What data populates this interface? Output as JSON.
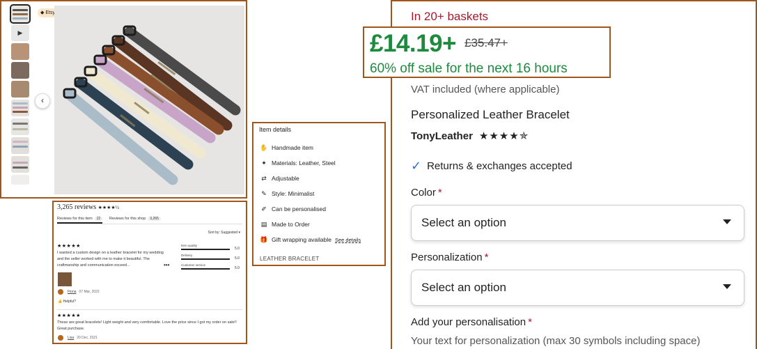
{
  "gallery": {
    "badge": "Etsy's Pick",
    "prev_glyph": "‹",
    "play_glyph": "▶",
    "thumb_count": 10
  },
  "reviews": {
    "count_label": "3,265 reviews",
    "stars": "★★★★½",
    "tab_item": "Reviews for this item",
    "tab_item_count": "22",
    "tab_shop": "Reviews for this shop",
    "tab_shop_count": "3,265",
    "sort_label": "Sort by: Suggested",
    "items": [
      {
        "stars": "★★★★★",
        "text": "I wanted a custom design on a leather bracelet for my wedding and the seller worked with me to make it beautiful. The craftmanship and communication exceed...",
        "author": "Fiona",
        "date": "07 Mar, 2022",
        "helpful": "Helpful?"
      },
      {
        "stars": "★★★★★",
        "text": "These are great bracelets! Light weight and very comfortable. Love the price since I got my order on sale!! Great purchase.",
        "author": "Lisa",
        "date": "20 Dec, 2021"
      }
    ],
    "ratings": [
      {
        "label": "Item quality",
        "value": "5.0"
      },
      {
        "label": "Delivery",
        "value": "5.0"
      },
      {
        "label": "Customer service",
        "value": "5.0"
      }
    ]
  },
  "details": {
    "title": "Item details",
    "rows": [
      {
        "icon": "hand-icon",
        "glyph": "✋",
        "label": "Handmade item"
      },
      {
        "icon": "materials-icon",
        "glyph": "✦",
        "label": "Materials: Leather, Steel"
      },
      {
        "icon": "adjustable-icon",
        "glyph": "⇄",
        "label": "Adjustable"
      },
      {
        "icon": "brush-icon",
        "glyph": "✎",
        "label": "Style: Minimalist"
      },
      {
        "icon": "personalise-icon",
        "glyph": "✐",
        "label": "Can be personalised"
      },
      {
        "icon": "clipboard-icon",
        "glyph": "▤",
        "label": "Made to Order"
      },
      {
        "icon": "gift-icon",
        "glyph": "🎁",
        "label": "Gift wrapping available",
        "link": "See details"
      }
    ],
    "footer": "LEATHER BRACELET"
  },
  "buybox": {
    "baskets": "In 20+ baskets",
    "price_now": "£14.19+",
    "price_was": "£35.47+",
    "sale_msg": "60% off sale for the next 16 hours",
    "vat": "VAT included (where applicable)",
    "title": "Personalized Leather Bracelet",
    "shop": "TonyLeather",
    "shop_stars": "★★★★✯",
    "returns": "Returns & exchanges accepted",
    "color_label": "Color",
    "personalization_label": "Personalization",
    "select_placeholder": "Select an option",
    "add_personalisation_label": "Add your personalisation",
    "personalisation_hint": "Your text for personalization (max 30 symbols including space)",
    "required_mark": "*"
  },
  "colors": {
    "frame": "#a0561a",
    "price_green": "#1e8a3e",
    "basket_red": "#a61a2e"
  }
}
